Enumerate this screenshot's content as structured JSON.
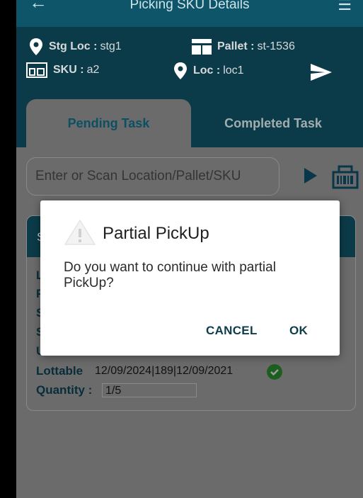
{
  "appbar": {
    "title": "Picking SKU Details"
  },
  "info": {
    "stg_loc_label": "Stg Loc :",
    "stg_loc_value": "stg1",
    "pallet_label": "Pallet :",
    "pallet_value": "st-1536",
    "sku_label": "SKU :",
    "sku_value": "a2",
    "loc_label": "Loc :",
    "loc_value": "loc1"
  },
  "tabs": {
    "pending": "Pending Task",
    "completed": "Completed Task"
  },
  "search": {
    "placeholder": "Enter or Scan Location/Pallet/SKU",
    "value": ""
  },
  "card": {
    "header_initial": "S",
    "row_initials": [
      "L",
      "P",
      "S",
      "S",
      "U"
    ],
    "lottable_label": "Lottable",
    "lottable_value": "12/09/2024|189|12/09/2021",
    "quantity_label": "Quantity :",
    "quantity_value": "1/5"
  },
  "dialog": {
    "title": "Partial PickUp",
    "message": "Do you want to continue with partial PickUp?",
    "cancel": "CANCEL",
    "ok": "OK"
  },
  "colors": {
    "primary": "#0b3b49",
    "accent": "#0d4f63",
    "check": "#2e7d32"
  }
}
